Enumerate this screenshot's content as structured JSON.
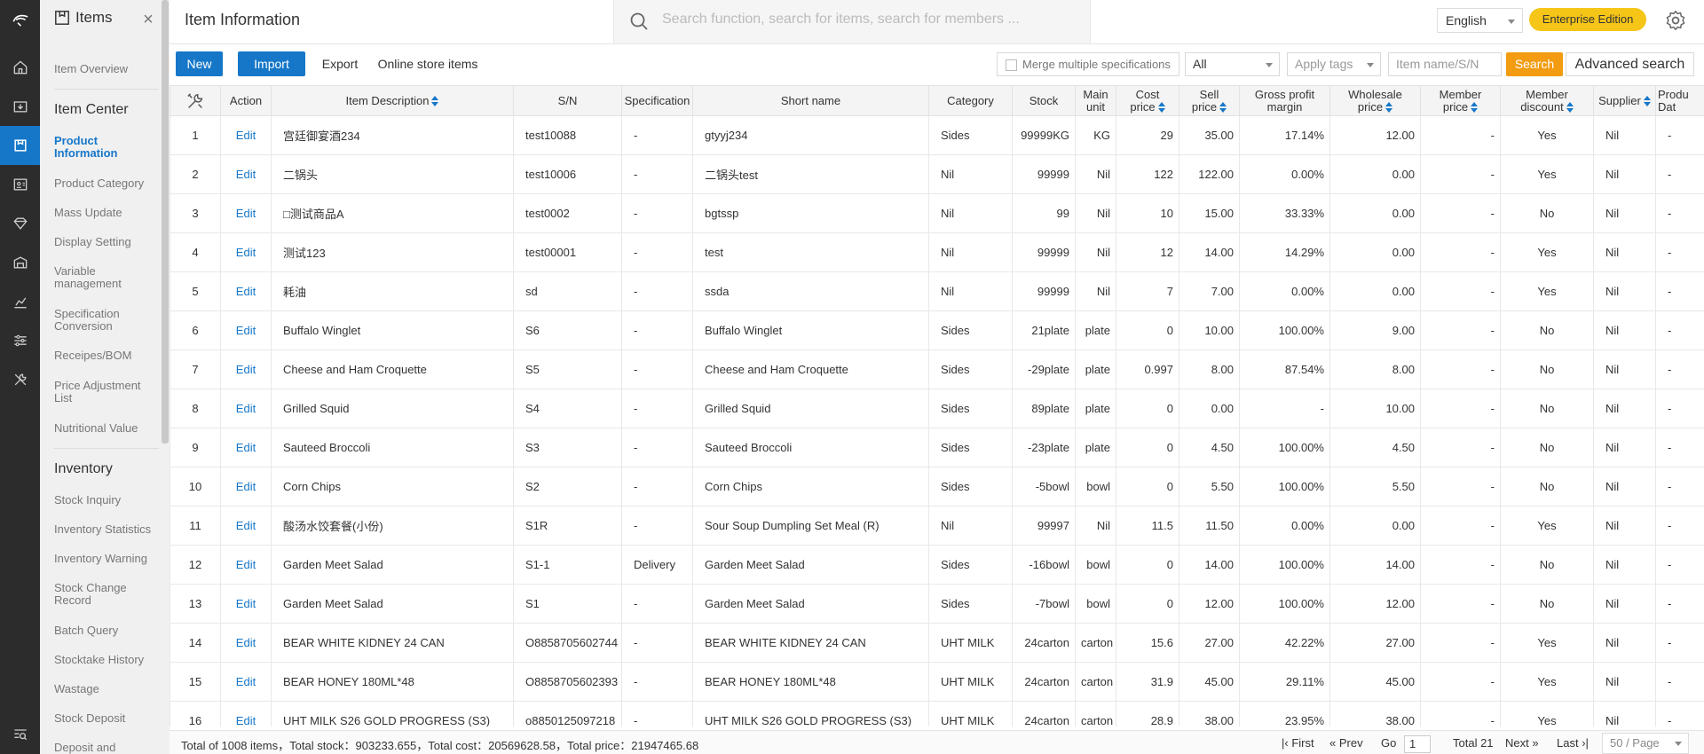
{
  "side": {
    "title": "Items",
    "close": "×",
    "links": [
      {
        "label": "Item Overview"
      },
      {
        "label": "Item Center",
        "group": true
      },
      {
        "label": "Product Information",
        "active": true
      },
      {
        "label": "Product Category"
      },
      {
        "label": "Mass Update"
      },
      {
        "label": "Display Setting"
      },
      {
        "label": "Variable management"
      },
      {
        "label": "Specification Conversion"
      },
      {
        "label": "Receipes/BOM"
      },
      {
        "label": "Price Adjustment List"
      },
      {
        "label": "Nutritional Value"
      },
      {
        "label": "Inventory",
        "group": true
      },
      {
        "label": "Stock Inquiry"
      },
      {
        "label": "Inventory Statistics"
      },
      {
        "label": "Inventory Warning"
      },
      {
        "label": "Stock Change Record"
      },
      {
        "label": "Batch Query"
      },
      {
        "label": "Stocktake History"
      },
      {
        "label": "Wastage"
      },
      {
        "label": "Stock Deposit"
      },
      {
        "label": "Deposit and"
      }
    ]
  },
  "header": {
    "title": "Item Information",
    "search_placeholder": "Search function, search for items, search for members ...",
    "language": "English",
    "edition": "Enterprise Edition"
  },
  "toolbar": {
    "new": "New",
    "import": "Import",
    "export": "Export",
    "online": "Online store items",
    "merge": "Merge multiple specifications",
    "all": "All",
    "tags": "Apply tags",
    "name_placeholder": "Item name/S/N",
    "search": "Search",
    "advanced": "Advanced search"
  },
  "table": {
    "headers": {
      "action": "Action",
      "desc": "Item Description",
      "sn": "S/N",
      "spec": "Specification",
      "short": "Short name",
      "category": "Category",
      "stock": "Stock",
      "unit_1": "Main",
      "unit_2": "unit",
      "cost_1": "Cost",
      "cost_2": "price",
      "sell_1": "Sell",
      "sell_2": "price",
      "margin_1": "Gross profit",
      "margin_2": "margin",
      "wholesale_1": "Wholesale",
      "wholesale_2": "price",
      "member_1": "Member",
      "member_2": "price",
      "mdisc_1": "Member",
      "mdisc_2": "discount",
      "supplier": "Supplier",
      "prod_1": "Produ",
      "prod_2": "Dat"
    },
    "edit_label": "Edit",
    "rows": [
      {
        "no": "1",
        "desc": "宫廷御宴酒234",
        "sn": "test10088",
        "spec": "-",
        "short": "gtyyj234",
        "cat": "Sides",
        "stock": "99999KG",
        "unit": "KG",
        "cost": "29",
        "sell": "35.00",
        "margin": "17.14%",
        "wholesale": "12.00",
        "member": "-",
        "mdisc": "Yes",
        "supplier": "Nil",
        "prod": "-"
      },
      {
        "no": "2",
        "desc": "二锅头",
        "sn": "test10006",
        "spec": "-",
        "short": "二锅头test",
        "cat": "Nil",
        "stock": "99999",
        "unit": "Nil",
        "cost": "122",
        "sell": "122.00",
        "margin": "0.00%",
        "wholesale": "0.00",
        "member": "-",
        "mdisc": "Yes",
        "supplier": "Nil",
        "prod": "-"
      },
      {
        "no": "3",
        "desc": "□测试商品A",
        "sn": "test0002",
        "spec": "-",
        "short": "bgtssp",
        "cat": "Nil",
        "stock": "99",
        "unit": "Nil",
        "cost": "10",
        "sell": "15.00",
        "margin": "33.33%",
        "wholesale": "0.00",
        "member": "-",
        "mdisc": "No",
        "supplier": "Nil",
        "prod": "-"
      },
      {
        "no": "4",
        "desc": "测试123",
        "sn": "test00001",
        "spec": "-",
        "short": "test",
        "cat": "Nil",
        "stock": "99999",
        "unit": "Nil",
        "cost": "12",
        "sell": "14.00",
        "margin": "14.29%",
        "wholesale": "0.00",
        "member": "-",
        "mdisc": "Yes",
        "supplier": "Nil",
        "prod": "-"
      },
      {
        "no": "5",
        "desc": "耗油",
        "sn": "sd",
        "spec": "-",
        "short": "ssda",
        "cat": "Nil",
        "stock": "99999",
        "unit": "Nil",
        "cost": "7",
        "sell": "7.00",
        "margin": "0.00%",
        "wholesale": "0.00",
        "member": "-",
        "mdisc": "Yes",
        "supplier": "Nil",
        "prod": "-"
      },
      {
        "no": "6",
        "desc": "Buffalo Winglet",
        "sn": "S6",
        "spec": "-",
        "short": "Buffalo Winglet",
        "cat": "Sides",
        "stock": "21plate",
        "unit": "plate",
        "cost": "0",
        "sell": "10.00",
        "margin": "100.00%",
        "wholesale": "9.00",
        "member": "-",
        "mdisc": "No",
        "supplier": "Nil",
        "prod": "-"
      },
      {
        "no": "7",
        "desc": "Cheese and Ham Croquette",
        "sn": "S5",
        "spec": "-",
        "short": "Cheese and Ham Croquette",
        "cat": "Sides",
        "stock": "-29plate",
        "unit": "plate",
        "cost": "0.997",
        "sell": "8.00",
        "margin": "87.54%",
        "wholesale": "8.00",
        "member": "-",
        "mdisc": "No",
        "supplier": "Nil",
        "prod": "-"
      },
      {
        "no": "8",
        "desc": "Grilled Squid",
        "sn": "S4",
        "spec": "-",
        "short": "Grilled Squid",
        "cat": "Sides",
        "stock": "89plate",
        "unit": "plate",
        "cost": "0",
        "sell": "0.00",
        "margin": "-",
        "wholesale": "10.00",
        "member": "-",
        "mdisc": "No",
        "supplier": "Nil",
        "prod": "-"
      },
      {
        "no": "9",
        "desc": "Sauteed Broccoli",
        "sn": "S3",
        "spec": "-",
        "short": "Sauteed Broccoli",
        "cat": "Sides",
        "stock": "-23plate",
        "unit": "plate",
        "cost": "0",
        "sell": "4.50",
        "margin": "100.00%",
        "wholesale": "4.50",
        "member": "-",
        "mdisc": "No",
        "supplier": "Nil",
        "prod": "-"
      },
      {
        "no": "10",
        "desc": "Corn Chips",
        "sn": "S2",
        "spec": "-",
        "short": "Corn Chips",
        "cat": "Sides",
        "stock": "-5bowl",
        "unit": "bowl",
        "cost": "0",
        "sell": "5.50",
        "margin": "100.00%",
        "wholesale": "5.50",
        "member": "-",
        "mdisc": "No",
        "supplier": "Nil",
        "prod": "-"
      },
      {
        "no": "11",
        "desc": "酸汤水饺套餐(小份)",
        "sn": "S1R",
        "spec": "-",
        "short": "Sour Soup Dumpling Set Meal (R)",
        "cat": "Nil",
        "stock": "99997",
        "unit": "Nil",
        "cost": "11.5",
        "sell": "11.50",
        "margin": "0.00%",
        "wholesale": "0.00",
        "member": "-",
        "mdisc": "Yes",
        "supplier": "Nil",
        "prod": "-"
      },
      {
        "no": "12",
        "desc": "Garden Meet Salad",
        "sn": "S1-1",
        "spec": "Delivery",
        "short": "Garden Meet Salad",
        "cat": "Sides",
        "stock": "-16bowl",
        "unit": "bowl",
        "cost": "0",
        "sell": "14.00",
        "margin": "100.00%",
        "wholesale": "14.00",
        "member": "-",
        "mdisc": "No",
        "supplier": "Nil",
        "prod": "-"
      },
      {
        "no": "13",
        "desc": "Garden Meet Salad",
        "sn": "S1",
        "spec": "-",
        "short": "Garden Meet Salad",
        "cat": "Sides",
        "stock": "-7bowl",
        "unit": "bowl",
        "cost": "0",
        "sell": "12.00",
        "margin": "100.00%",
        "wholesale": "12.00",
        "member": "-",
        "mdisc": "No",
        "supplier": "Nil",
        "prod": "-"
      },
      {
        "no": "14",
        "desc": "BEAR WHITE KIDNEY 24 CAN",
        "sn": "O8858705602744",
        "spec": "-",
        "short": "BEAR WHITE KIDNEY 24 CAN",
        "cat": "UHT MILK",
        "stock": "24carton",
        "unit": "carton",
        "cost": "15.6",
        "sell": "27.00",
        "margin": "42.22%",
        "wholesale": "27.00",
        "member": "-",
        "mdisc": "Yes",
        "supplier": "Nil",
        "prod": "-"
      },
      {
        "no": "15",
        "desc": "BEAR HONEY 180ML*48",
        "sn": "O8858705602393",
        "spec": "-",
        "short": "BEAR HONEY 180ML*48",
        "cat": "UHT MILK",
        "stock": "24carton",
        "unit": "carton",
        "cost": "31.9",
        "sell": "45.00",
        "margin": "29.11%",
        "wholesale": "45.00",
        "member": "-",
        "mdisc": "Yes",
        "supplier": "Nil",
        "prod": "-"
      },
      {
        "no": "16",
        "desc": "UHT MILK S26 GOLD PROGRESS (S3)",
        "sn": "o8850125097218",
        "spec": "-",
        "short": "UHT MILK S26 GOLD PROGRESS (S3)",
        "cat": "UHT MILK",
        "stock": "24carton",
        "unit": "carton",
        "cost": "28.9",
        "sell": "38.00",
        "margin": "23.95%",
        "wholesale": "38.00",
        "member": "-",
        "mdisc": "Yes",
        "supplier": "Nil",
        "prod": "-"
      }
    ]
  },
  "footer": {
    "summary": "Total of 1008 items，Total stock：903233.655，Total cost：20569628.58，Total price：21947465.68",
    "first": "First",
    "prev": "Prev",
    "go": "Go",
    "page": "1",
    "total": "Total 21",
    "next": "Next",
    "last": "Last",
    "page_size": "50 / Page"
  },
  "colors": {
    "primary": "#1677c9",
    "search": "#f39c12",
    "edition": "#f5c518",
    "rail": "#2c2c2c"
  }
}
